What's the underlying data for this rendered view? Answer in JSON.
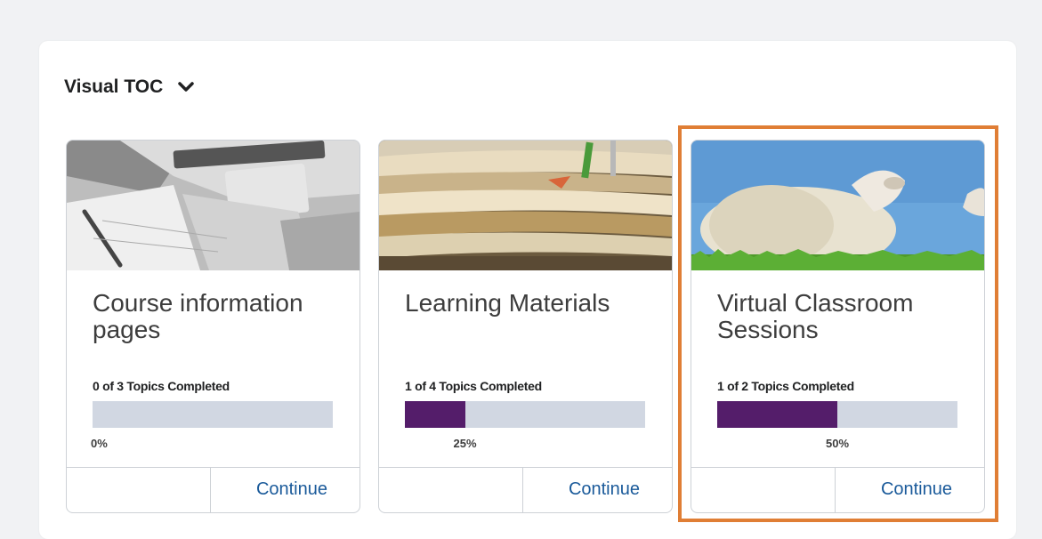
{
  "toc": {
    "title": "Visual TOC",
    "toggle_icon": "chevron-down-icon"
  },
  "cards": [
    {
      "title": "Course information pages",
      "completed_text": "0 of 3 Topics Completed",
      "progress": 0,
      "percent_label": "0%",
      "action_label": "Continue",
      "image": "laptop-desk-image"
    },
    {
      "title": "Learning Materials",
      "completed_text": "1 of 4 Topics Completed",
      "progress": 0.25,
      "percent_label": "25%",
      "action_label": "Continue",
      "image": "stacked-books-image"
    },
    {
      "title": "Virtual Classroom Sessions",
      "completed_text": "1 of 2 Topics Completed",
      "progress": 0.5,
      "percent_label": "50%",
      "action_label": "Continue",
      "image": "sheep-image"
    }
  ],
  "colors": {
    "progress_fill": "#541d6a",
    "progress_track": "#d1d7e2",
    "link": "#1a5a9a",
    "highlight": "#e07e35"
  }
}
